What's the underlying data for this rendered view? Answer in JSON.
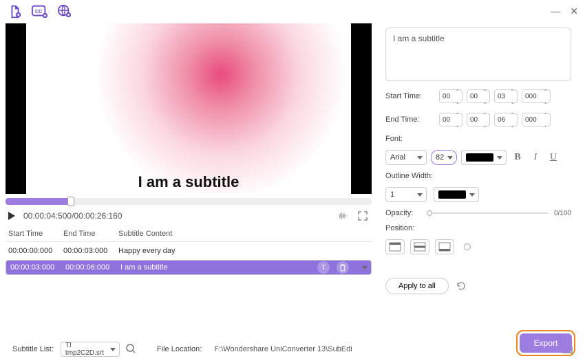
{
  "toolbar": {
    "icons": [
      "add-file-icon",
      "add-cc-icon",
      "web-subtitle-icon"
    ]
  },
  "preview": {
    "overlay_text": "I am a subtitle"
  },
  "player": {
    "current_time": "00:00:04:500",
    "duration": "00:00:26:160"
  },
  "table": {
    "headers": {
      "start": "Start Time",
      "end": "End Time",
      "content": "Subtitle Content"
    },
    "rows": [
      {
        "start": "00:00:00:000",
        "end": "00:00:03:000",
        "content": "Happy every day"
      },
      {
        "start": "00:00:03:000",
        "end": "00:00:06:000",
        "content": "I am a subtitle"
      }
    ]
  },
  "editor": {
    "subtitle_text": "I am a subtitle",
    "start_label": "Start Time:",
    "end_label": "End Time:",
    "start": {
      "hh": "00",
      "mm": "00",
      "ss": "03",
      "ms": "000"
    },
    "end": {
      "hh": "00",
      "mm": "00",
      "ss": "06",
      "ms": "000"
    },
    "font_label": "Font:",
    "font_name": "Arial",
    "font_size": "82",
    "outline_label": "Outline Width:",
    "outline_value": "1",
    "opacity_label": "Opacity:",
    "opacity_text": "0/100",
    "position_label": "Position:",
    "apply_label": "Apply to all"
  },
  "footer": {
    "list_label": "Subtitle List:",
    "list_value": "TI tmp2C2D.srt",
    "loc_label": "File Location:",
    "loc_value": "F:\\Wondershare UniConverter 13\\SubEdi",
    "export_label": "Export"
  }
}
